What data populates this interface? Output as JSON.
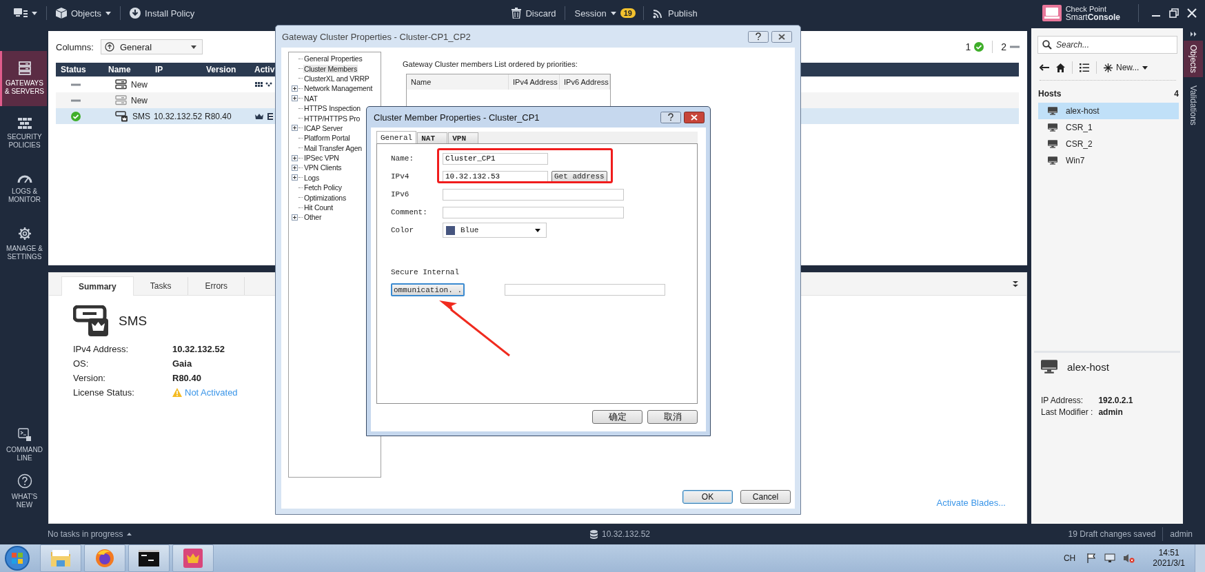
{
  "top_bar": {
    "items": [
      {
        "kind": "objects",
        "label": "Objects",
        "dropdown": true
      },
      {
        "kind": "install",
        "label": "Install Policy",
        "dropdown": false
      }
    ],
    "discard": "Discard",
    "session": "Session",
    "session_badge": "19",
    "publish": "Publish",
    "brand_top": "Check Point",
    "brand_bottom": "Smart**Console**"
  },
  "nav": {
    "top": [
      {
        "kind": "gateways",
        "label": "GATEWAYS & SERVERS",
        "selected": true
      },
      {
        "kind": "policies",
        "label": "SECURITY POLICIES",
        "selected": false
      },
      {
        "kind": "logs",
        "label": "LOGS & MONITOR",
        "selected": false
      },
      {
        "kind": "manage",
        "label": "MANAGE & SETTINGS",
        "selected": false
      }
    ],
    "bottom": [
      {
        "kind": "command",
        "label": "COMMAND LINE"
      },
      {
        "kind": "whatsnew",
        "label": "WHAT'S NEW"
      }
    ]
  },
  "gateways": {
    "columns_label": "Columns:",
    "columns_value": "General",
    "status_counts": [
      {
        "kind": "ok",
        "count": "1"
      },
      {
        "kind": "pending",
        "count": "2"
      }
    ],
    "columns": [
      "Status",
      "Name",
      "IP",
      "Version",
      "Activ"
    ],
    "rows": [
      {
        "ok": false,
        "kind": "cluster",
        "name": "New",
        "selected": false
      },
      {
        "ok": false,
        "kind": "gateway",
        "name": "New",
        "selected": false
      },
      {
        "ok": true,
        "kind": "management",
        "name": "SMS",
        "ip": "10.32.132.52",
        "version": "R80.40",
        "selected": true
      }
    ]
  },
  "summary": {
    "tabs": [
      {
        "label": "Summary",
        "selected": true
      },
      {
        "label": "Tasks",
        "selected": false
      },
      {
        "label": "Errors",
        "selected": false
      }
    ],
    "title": "SMS",
    "fields": [
      {
        "label": "IPv4 Address:",
        "value": "10.32.132.52",
        "kind": "plain"
      },
      {
        "label": "OS:",
        "value": "Gaia",
        "kind": "plain"
      },
      {
        "label": "Version:",
        "value": "R80.40",
        "kind": "plain"
      },
      {
        "label": "License Status:",
        "value": "Not Activated",
        "kind": "warning"
      }
    ],
    "link": "Activate Blades..."
  },
  "objects_panel": {
    "search_placeholder": "Search...",
    "new_button": "New...",
    "section": "Hosts",
    "count": "4",
    "items": [
      {
        "label": "alex-host",
        "selected": true
      },
      {
        "label": "CSR_1",
        "selected": false
      },
      {
        "label": "CSR_2",
        "selected": false
      },
      {
        "label": "Win7",
        "selected": false
      }
    ],
    "detail": {
      "title": "alex-host",
      "fields": [
        {
          "label": "IP Address:",
          "value": "192.0.2.1"
        },
        {
          "label": "Last Modifier :",
          "value": "admin"
        }
      ]
    }
  },
  "side_tabs": [
    {
      "label": "Objects",
      "selected": true
    },
    {
      "label": "Validations",
      "selected": false
    }
  ],
  "status_bar": {
    "tasks": "No tasks in progress",
    "server": "10.32.132.52",
    "drafts": "19 Draft changes saved",
    "user": "admin"
  },
  "taskbar": {
    "apps": [
      {
        "kind": "explorer"
      },
      {
        "kind": "browser"
      },
      {
        "kind": "terminal"
      },
      {
        "kind": "console"
      }
    ],
    "language": "CH",
    "time": "14:51",
    "date": "2021/3/1"
  },
  "gateway_dialog": {
    "title": "Gateway Cluster Properties - Cluster-CP1_CP2",
    "tree": [
      {
        "label": "General Properties",
        "has_children": false,
        "selected": false
      },
      {
        "label": "Cluster Members",
        "has_children": false,
        "selected": true
      },
      {
        "label": "ClusterXL and VRRP",
        "has_children": false,
        "selected": false
      },
      {
        "label": "Network Management",
        "has_children": true,
        "selected": false
      },
      {
        "label": "NAT",
        "has_children": true,
        "selected": false
      },
      {
        "label": "HTTPS Inspection",
        "has_children": false,
        "selected": false
      },
      {
        "label": "HTTP/HTTPS Pro",
        "has_children": false,
        "selected": false
      },
      {
        "label": "ICAP Server",
        "has_children": true,
        "selected": false
      },
      {
        "label": "Platform Portal",
        "has_children": false,
        "selected": false
      },
      {
        "label": "Mail Transfer Agen",
        "has_children": false,
        "selected": false
      },
      {
        "label": "IPSec VPN",
        "has_children": true,
        "selected": false
      },
      {
        "label": "VPN Clients",
        "has_children": true,
        "selected": false
      },
      {
        "label": "Logs",
        "has_children": true,
        "selected": false
      },
      {
        "label": "Fetch Policy",
        "has_children": false,
        "selected": false
      },
      {
        "label": "Optimizations",
        "has_children": false,
        "selected": false
      },
      {
        "label": "Hit Count",
        "has_children": false,
        "selected": false
      },
      {
        "label": "Other",
        "has_children": true,
        "selected": false
      }
    ],
    "members_label": "Gateway Cluster members List ordered by priorities:",
    "members_columns": [
      "Name",
      "IPv4 Address",
      "IPv6 Address"
    ],
    "buttons": [
      {
        "label": "OK",
        "default": true
      },
      {
        "label": "Cancel",
        "default": false
      }
    ]
  },
  "member_dialog": {
    "title": "Cluster Member Properties - Cluster_CP1",
    "tabs": [
      {
        "label": "General",
        "selected": true
      },
      {
        "label": "NAT",
        "selected": false
      },
      {
        "label": "VPN",
        "selected": false
      }
    ],
    "fields": [
      {
        "kind": "short",
        "label": "Name:",
        "value": "Cluster_CP1"
      },
      {
        "kind": "short_button",
        "label": "IPv4",
        "value": "10.32.132.53",
        "button": "Get address"
      },
      {
        "kind": "long",
        "label": "IPv6"
      },
      {
        "kind": "long",
        "label": "Comment:"
      },
      {
        "kind": "select",
        "label": "Color",
        "value": "Blue",
        "color": "#46557f"
      }
    ],
    "secure_label": "Secure Internal",
    "communication_button": "ommunication. .",
    "buttons": [
      "确定",
      "取消"
    ],
    "highlight_frame": true,
    "pointer_arrow": true
  }
}
